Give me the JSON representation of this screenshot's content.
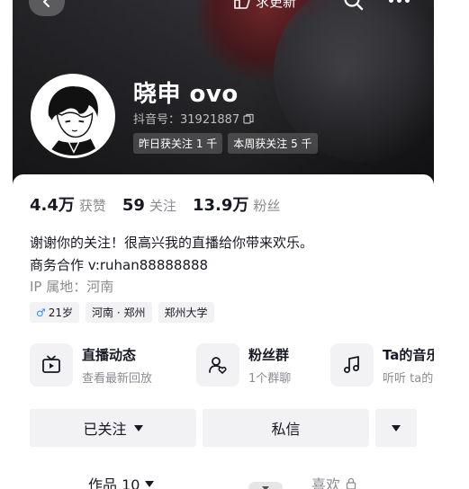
{
  "header": {
    "request_update_label": "求更新",
    "back_icon": "chevron-left-icon",
    "search_icon": "search-icon",
    "more_icon": "more-dots-icon"
  },
  "profile": {
    "nickname": "晓申 ovo",
    "douyin_id": "抖音号：31921887",
    "badges": [
      "昨日获关注 1 千",
      "本周获关注 5 千"
    ]
  },
  "stats": [
    {
      "num": "4.4万",
      "label": "获赞"
    },
    {
      "num": "59",
      "label": "关注"
    },
    {
      "num": "13.9万",
      "label": "粉丝"
    }
  ],
  "bio": {
    "line1": "谢谢你的关注！很高兴我的直播给你带来欢乐。",
    "line2": "商务合作 v:ruhan88888888",
    "ip": "IP 属地：河南"
  },
  "tags": {
    "gender_symbol": "♂",
    "age": "21岁",
    "location": "河南 · 郑州",
    "school": "郑州大学"
  },
  "shortcuts": [
    {
      "title": "直播动态",
      "subtitle": "查看最新回放",
      "icon": "tv-icon"
    },
    {
      "title": "粉丝群",
      "subtitle": "1个群聊",
      "icon": "fan-group-icon"
    },
    {
      "title": "Ta的音乐",
      "subtitle": "听听 ta的",
      "icon": "music-icon"
    }
  ],
  "actions": {
    "follow_label": "已关注",
    "message_label": "私信"
  },
  "tabs": {
    "works_label": "作品 10",
    "likes_label": "喜欢"
  },
  "colors": {
    "accent_male": "#2e89ff",
    "text_primary": "#161823",
    "text_secondary": "#8a8b91",
    "button_bg": "#f2f2f4"
  }
}
